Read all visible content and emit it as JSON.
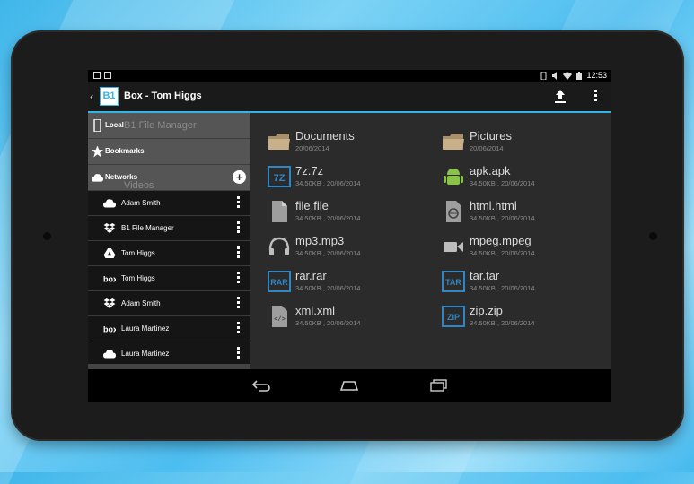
{
  "status_bar": {
    "time": "12:53"
  },
  "action_bar": {
    "title": "Box - Tom Higgs",
    "logo_text": "B1"
  },
  "sidebar": {
    "sections": [
      {
        "label": "Local",
        "ghost": "B1 File Manager",
        "icon": "phone-icon"
      },
      {
        "label": "Bookmarks",
        "ghost": "",
        "icon": "star-icon"
      },
      {
        "label": "Networks",
        "ghost": "Videos",
        "icon": "cloud-icon"
      }
    ],
    "accounts": [
      {
        "label": "Adam Smith",
        "icon": "onedrive-icon"
      },
      {
        "label": "B1 File Manager",
        "icon": "dropbox-icon"
      },
      {
        "label": "Tom Higgs",
        "icon": "google-drive-icon"
      },
      {
        "label": "Tom Higgs",
        "icon": "box-icon"
      },
      {
        "label": "Adam Smith",
        "icon": "dropbox-icon"
      },
      {
        "label": "Laura Martinez",
        "icon": "box-icon"
      },
      {
        "label": "Laura Martinez",
        "icon": "onedrive-icon"
      }
    ]
  },
  "files": [
    {
      "name": "Documents",
      "meta": "20/06/2014",
      "icon": "folder-icon"
    },
    {
      "name": "Pictures",
      "meta": "20/06/2014",
      "icon": "folder-icon"
    },
    {
      "name": "7z.7z",
      "meta": "34.50KB , 20/06/2014",
      "icon": "7z-icon"
    },
    {
      "name": "apk.apk",
      "meta": "34.50KB , 20/06/2014",
      "icon": "android-icon"
    },
    {
      "name": "file.file",
      "meta": "34.50KB , 20/06/2014",
      "icon": "file-icon"
    },
    {
      "name": "html.html",
      "meta": "34.50KB , 20/06/2014",
      "icon": "html-icon"
    },
    {
      "name": "mp3.mp3",
      "meta": "34.50KB , 20/06/2014",
      "icon": "headphones-icon"
    },
    {
      "name": "mpeg.mpeg",
      "meta": "34.50KB , 20/06/2014",
      "icon": "video-camera-icon"
    },
    {
      "name": "rar.rar",
      "meta": "34.50KB , 20/06/2014",
      "icon": "rar-icon"
    },
    {
      "name": "tar.tar",
      "meta": "34.50KB , 20/06/2014",
      "icon": "tar-icon"
    },
    {
      "name": "xml.xml",
      "meta": "34.50KB , 20/06/2014",
      "icon": "xml-icon"
    },
    {
      "name": "zip.zip",
      "meta": "34.50KB , 20/06/2014",
      "icon": "zip-icon"
    }
  ],
  "colors": {
    "accent": "#33b5e5",
    "archive_blue": "#2f86c4",
    "android_green": "#8bc34a"
  }
}
